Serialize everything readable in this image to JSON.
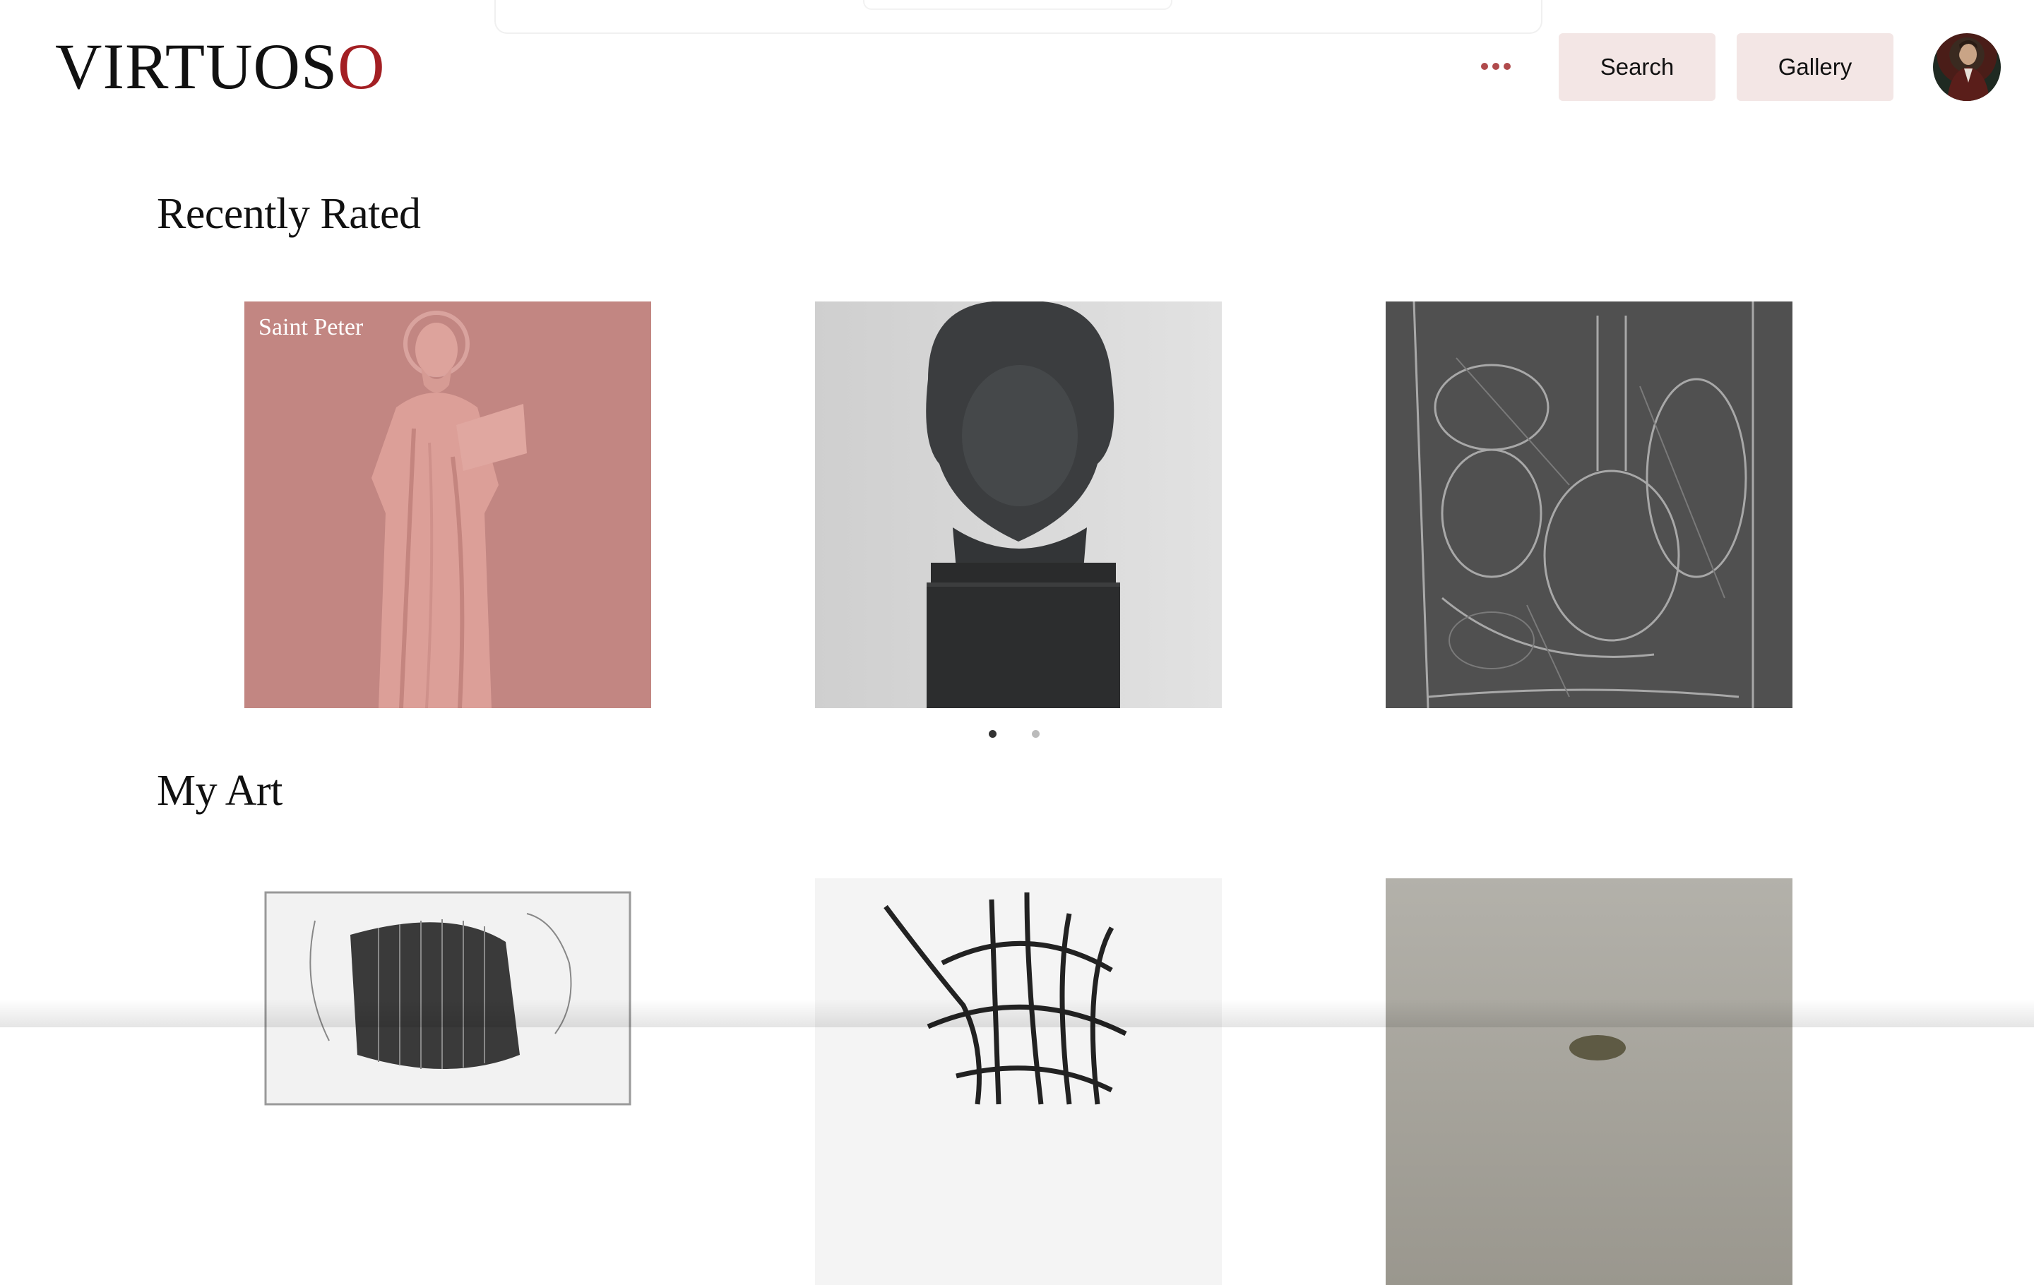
{
  "header": {
    "logo_main": "VIRTUOS",
    "logo_accent": "O",
    "more_icon": "more-horizontal-icon",
    "search_label": "Search",
    "gallery_label": "Gallery",
    "avatar_icon": "user-avatar"
  },
  "recently_rated": {
    "title": "Recently Rated",
    "items": [
      {
        "caption": "Saint Peter"
      },
      {
        "caption": ""
      },
      {
        "caption": ""
      }
    ],
    "pagination": {
      "count": 2,
      "active_index": 0
    }
  },
  "my_art": {
    "title": "My Art"
  },
  "colors": {
    "accent": "#a31f23",
    "button_bg": "#f3e6e5",
    "overlay": "#c07875"
  }
}
